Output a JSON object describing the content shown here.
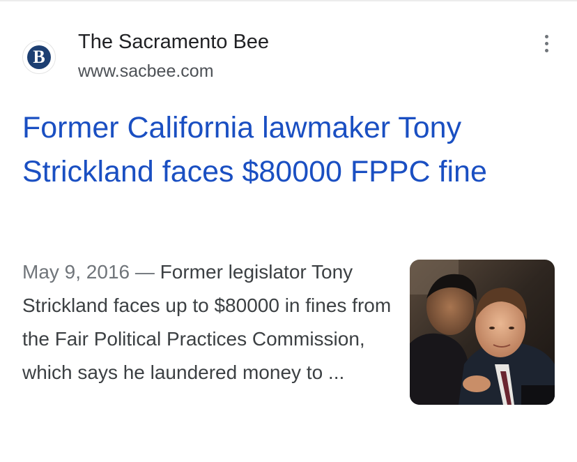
{
  "result": {
    "source": {
      "name": "The Sacramento Bee",
      "url": "www.sacbee.com",
      "favicon_letter": "B",
      "favicon_color": "#1d3f72",
      "more_icon": "more-vert-icon"
    },
    "headline": "Former California lawmaker Tony Strickland faces $80000 FPPC fine",
    "snippet": {
      "date": "May 9, 2016",
      "separator": " — ",
      "text": "Former legislator Tony Strickland faces up to $80000 in fines from the Fair Political Practices Commission, which says he laundered money to ..."
    }
  },
  "colors": {
    "headline_link": "#1a4fc2",
    "body_text": "#3c4043",
    "secondary_text": "#70757a"
  }
}
